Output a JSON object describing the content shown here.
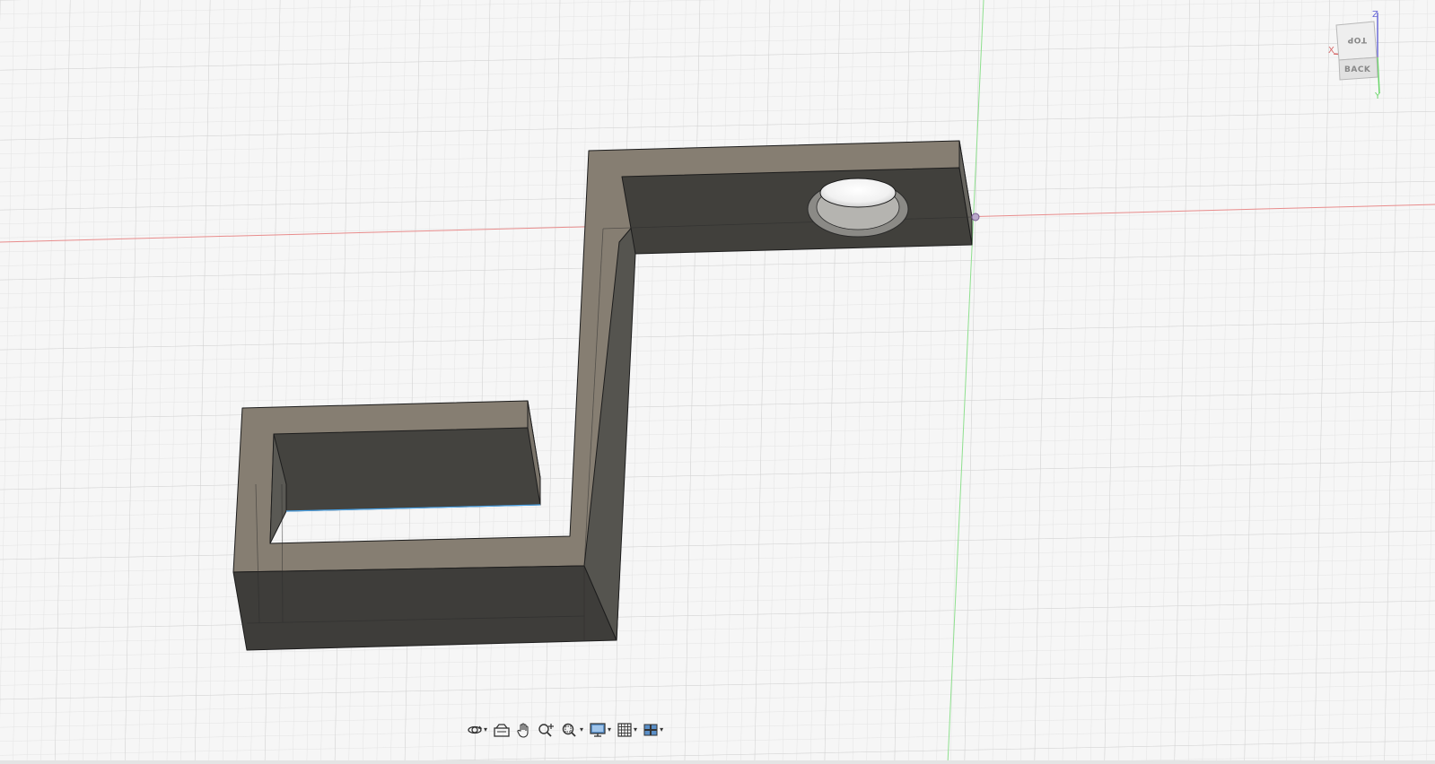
{
  "viewport": {
    "background_color": "#f6f6f6",
    "grid_minor_color": "#e2e2e2",
    "grid_major_color": "#d0d0d0",
    "x_axis_color": "#e88c8c",
    "y_axis_color": "#8fe08f",
    "model_top_face_color": "#857d71",
    "model_wall_color": "#3e3d39"
  },
  "viewcube": {
    "top_face_label": "TOP",
    "front_face_label": "BACK",
    "axis_z_label": "Z",
    "axis_x_label": "X",
    "axis_y_label": "Y",
    "axis_z_color": "#6b6bd6",
    "axis_x_color": "#d66b6b",
    "axis_y_color": "#6bd66b"
  },
  "toolbar": {
    "items": [
      {
        "name": "orbit-tool",
        "icon": "orbit-icon",
        "has_dropdown": true
      },
      {
        "name": "look-at-tool",
        "icon": "look-at-icon",
        "has_dropdown": false
      },
      {
        "name": "pan-tool",
        "icon": "hand-pan-icon",
        "has_dropdown": false
      },
      {
        "name": "zoom-tool",
        "icon": "zoom-icon",
        "has_dropdown": false
      },
      {
        "name": "fit-tool",
        "icon": "zoom-window-icon",
        "has_dropdown": true
      },
      {
        "name": "display-settings",
        "icon": "monitor-icon",
        "has_dropdown": true
      },
      {
        "name": "grid-and-snaps",
        "icon": "grid-icon",
        "has_dropdown": true
      },
      {
        "name": "viewports",
        "icon": "viewports-icon",
        "has_dropdown": true
      }
    ]
  }
}
